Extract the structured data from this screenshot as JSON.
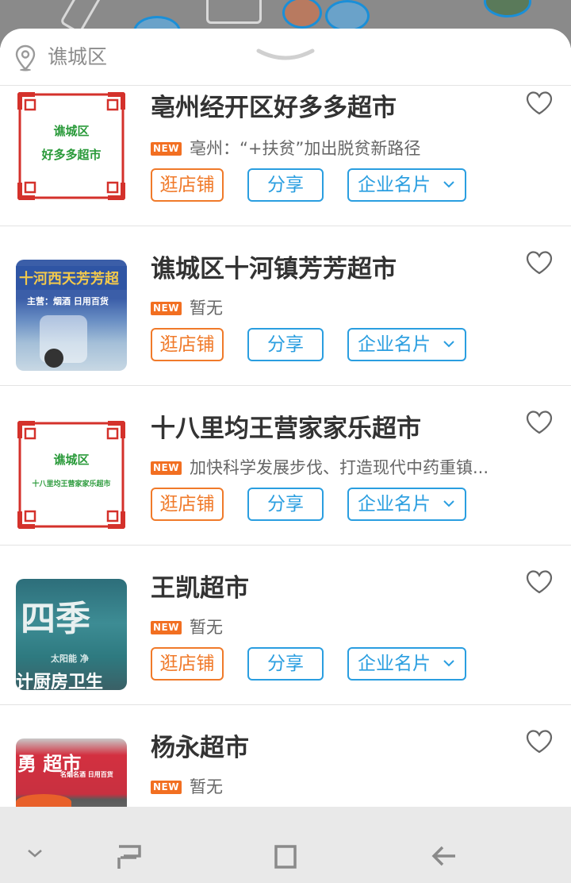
{
  "header": {
    "location_label": "谯城区"
  },
  "buttons": {
    "shop": "逛店铺",
    "share": "分享",
    "card": "企业名片"
  },
  "badge": "NEW",
  "stores": [
    {
      "title": "亳州经开区好多多超市",
      "news": "亳州：“+扶贫”加出脱贫新路径",
      "thumb": {
        "type": "frame",
        "line1": "谯城区",
        "line2": "好多多超市"
      }
    },
    {
      "title": "谯城区十河镇芳芳超市",
      "news": "暂无",
      "thumb": {
        "type": "photo",
        "sign": "十河西天芳芳超",
        "sub": "主营：烟酒 日用百货"
      }
    },
    {
      "title": "十八里均王营家家乐超市",
      "news": "加快科学发展步伐、打造现代中药重镇...",
      "thumb": {
        "type": "frame",
        "line1": "谯城区",
        "line2": "十八里均王营家家乐超市"
      }
    },
    {
      "title": "王凯超市",
      "news": "暂无",
      "thumb": {
        "type": "photo",
        "sign": "四季",
        "sub": "太阳能  净",
        "sub2": "计厨房卫生"
      }
    },
    {
      "title": "杨永超市",
      "news": "暂无",
      "thumb": {
        "type": "photo",
        "sign": "勇 超市",
        "sub": "名烟名酒 日用百货"
      }
    }
  ],
  "colors": {
    "orange": "#f07a2a",
    "blue": "#2a9ee0",
    "badge": "#f26f21",
    "frame_red": "#d4312b",
    "frame_text_green": "#2a9a3a"
  }
}
